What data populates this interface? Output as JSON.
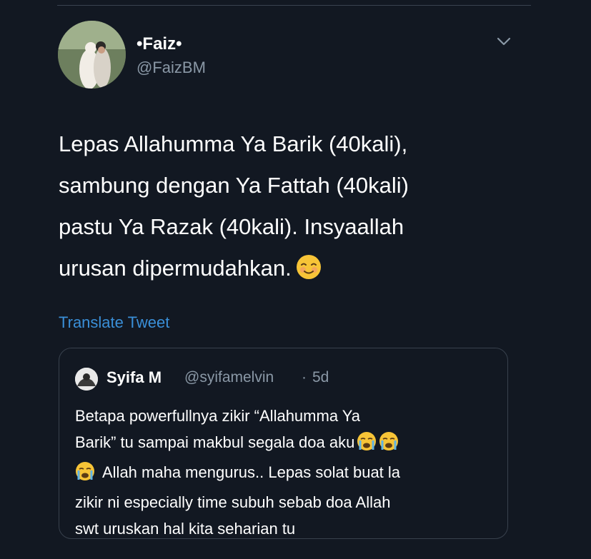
{
  "tweet": {
    "display_name": "•Faiz•",
    "handle": "@FaizBM",
    "text_lines": [
      "Lepas Allahumma Ya Barik (40kali),",
      "sambung dengan Ya Fattah (40kali)",
      "pastu Ya Razak (40kali). Insyaallah",
      "urusan dipermudahkan."
    ],
    "emoji": "smiling-face-icon",
    "translate_label": "Translate Tweet"
  },
  "quoted": {
    "name": "Syifa M",
    "handle": "@syifamelvin",
    "separator": "·",
    "time": "5d",
    "lines": [
      "Betapa powerfullnya zikir “Allahumma Ya",
      "Barik” tu sampai makbul segala doa aku",
      "Allah maha mengurus.. Lepas solat buat la",
      "zikir ni especially time subuh sebab doa Allah",
      "swt uruskan hal kita seharian tu"
    ],
    "emoji": "crying-face-icon"
  },
  "colors": {
    "background": "#121822",
    "link": "#3a8fd8",
    "secondary_text": "#8a98a6",
    "border": "#38414d"
  }
}
